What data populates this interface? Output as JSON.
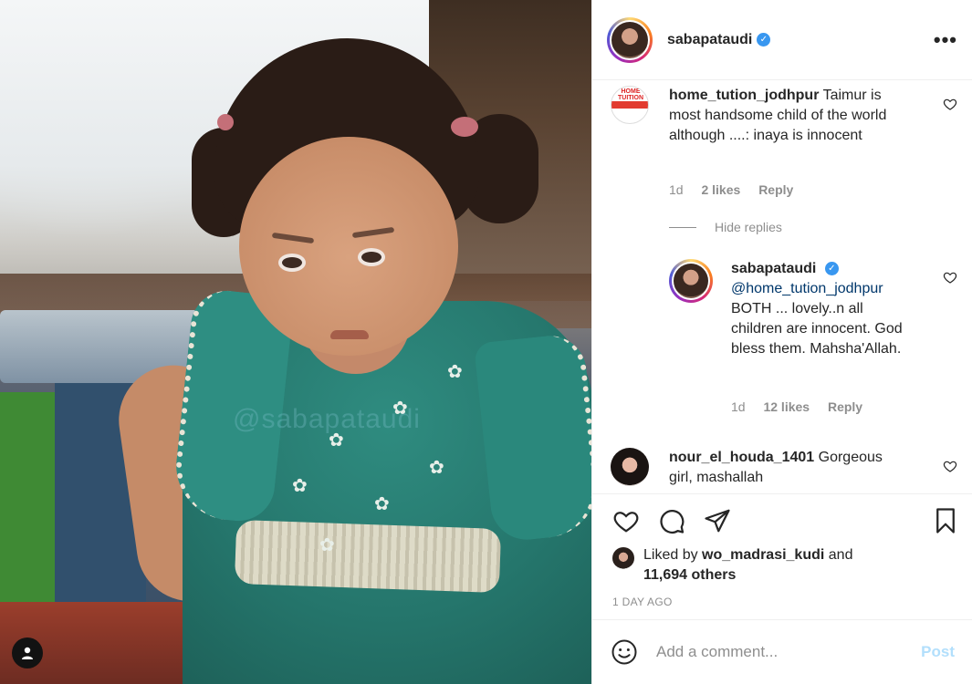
{
  "post": {
    "username": "sabapataudi",
    "verified": true,
    "more_icon": "more-options-icon",
    "watermark": "@sabapataudi"
  },
  "comments": [
    {
      "username": "home_tution_jodhpur",
      "text": "Taimur is most handsome child of the world although ....: inaya is innocent",
      "avatar_text": "HOME TUITION",
      "time": "1d",
      "likes": "2 likes",
      "reply_label": "Reply"
    },
    {
      "username": "sabapataudi",
      "mention": "@home_tution_jodhpur",
      "text": "BOTH ... lovely..n all children are innocent. God bless them. Mahsha'Allah.",
      "time": "1d",
      "likes": "12 likes",
      "reply_label": "Reply"
    },
    {
      "username": "nour_el_houda_1401",
      "text": "Gorgeous girl, mashallah"
    }
  ],
  "hide_replies": "Hide replies",
  "likes": {
    "prefix": "Liked by",
    "user": "wo_madrasi_kudi",
    "conj": "and",
    "others": "11,694 others"
  },
  "time_ago": "1 DAY AGO",
  "add_comment": {
    "placeholder": "Add a comment...",
    "post_label": "Post"
  },
  "colors": {
    "verified": "#3897f0",
    "post_disabled": "#b2dffc",
    "meta": "#8e8e8e"
  }
}
